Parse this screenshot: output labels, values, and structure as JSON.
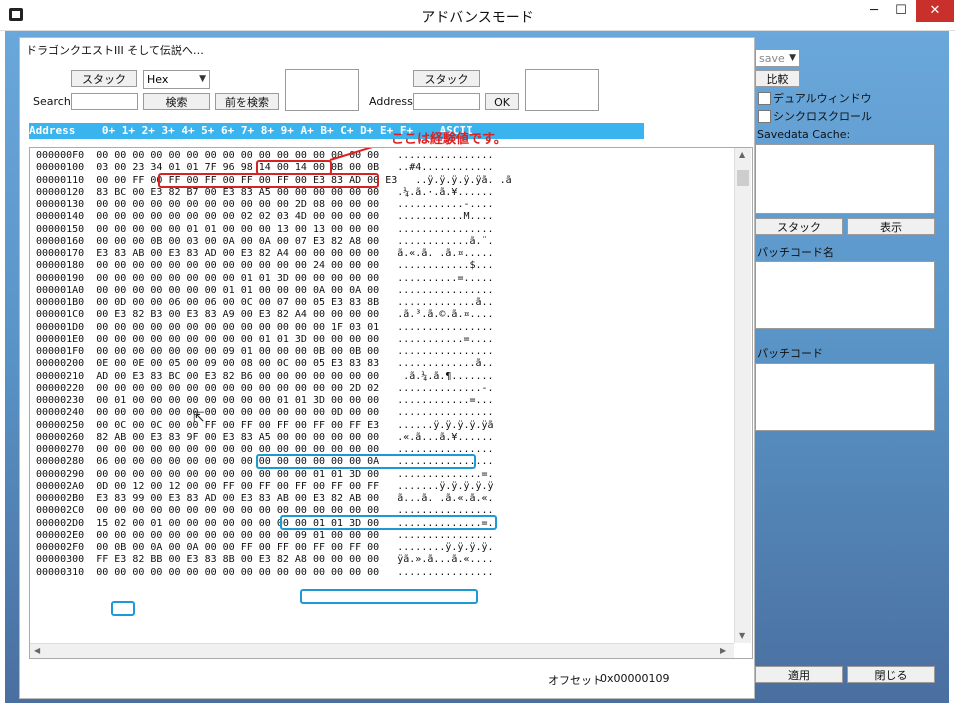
{
  "window": {
    "title": "アドバンスモード",
    "minimize": "─",
    "maximize": "☐",
    "close": "✕"
  },
  "game_title": "ドラゴンクエストIII そして伝説へ…",
  "search": {
    "stack_label": "スタック",
    "mode": "Hex",
    "label": "Search",
    "search_button": "検索",
    "prev_search_button": "前を検索",
    "value": ""
  },
  "address": {
    "stack_label": "スタック",
    "label": "Address",
    "ok_button": "OK",
    "value": ""
  },
  "hex_header": "Address    0+ 1+ 2+ 3+ 4+ 5+ 6+ 7+ 8+ 9+ A+ B+ C+ D+ E+ F+    ASCII",
  "rows": [
    {
      "addr": "000000F0",
      "hex": "00 00 00 00 00 00 00 00 00 00 00 00 00 00 00 00",
      "ascii": "................"
    },
    {
      "addr": "00000100",
      "hex": "03 00 23 34 01 01 7F 96 98 14 00 14 00 0B 00 0B",
      "ascii": "..#4............"
    },
    {
      "addr": "00000110",
      "hex": "00 00 FF 00 FF 00 FF 00 FF 00 FF 00 E3 83 AD 00 E3",
      "ascii": "..ÿ.ÿ.ÿ.ÿ.ÿã. .ã"
    },
    {
      "addr": "00000120",
      "hex": "83 BC 00 E3 82 B7 00 E3 83 A5 00 00 00 00 00 00",
      "ascii": ".¼.ã.·.ã.¥......"
    },
    {
      "addr": "00000130",
      "hex": "00 00 00 00 00 00 00 00 00 00 00 2D 08 00 00 00",
      "ascii": "...........-...."
    },
    {
      "addr": "00000140",
      "hex": "00 00 00 00 00 00 00 00 02 02 03 4D 00 00 00 00",
      "ascii": "...........M...."
    },
    {
      "addr": "00000150",
      "hex": "00 00 00 00 00 01 01 00 00 00 13 00 13 00 00 00",
      "ascii": "................"
    },
    {
      "addr": "00000160",
      "hex": "00 00 00 0B 00 03 00 0A 00 0A 00 07 E3 82 A8 00",
      "ascii": "............ã.¨."
    },
    {
      "addr": "00000170",
      "hex": "E3 83 AB 00 E3 83 AD 00 E3 82 A4 00 00 00 00 00",
      "ascii": "ã.«.ã. .ã.¤....."
    },
    {
      "addr": "00000180",
      "hex": "00 00 00 00 00 00 00 00 00 00 00 00 24 00 00 00",
      "ascii": "............$..."
    },
    {
      "addr": "00000190",
      "hex": "00 00 00 00 00 00 00 00 01 01 3D 00 00 00 00 00",
      "ascii": "..........=....."
    },
    {
      "addr": "000001A0",
      "hex": "00 00 00 00 00 00 00 01 01 00 00 00 0A 00 0A 00",
      "ascii": "................"
    },
    {
      "addr": "000001B0",
      "hex": "00 0D 00 00 06 00 06 00 0C 00 07 00 05 E3 83 8B",
      "ascii": ".............ã.."
    },
    {
      "addr": "000001C0",
      "hex": "00 E3 82 B3 00 E3 83 A9 00 E3 82 A4 00 00 00 00",
      "ascii": ".ã.³.ã.©.ã.¤...."
    },
    {
      "addr": "000001D0",
      "hex": "00 00 00 00 00 00 00 00 00 00 00 00 00 1F 03 01",
      "ascii": "................"
    },
    {
      "addr": "000001E0",
      "hex": "00 00 00 00 00 00 00 00 00 01 01 3D 00 00 00 00",
      "ascii": "...........=...."
    },
    {
      "addr": "000001F0",
      "hex": "00 00 00 00 00 00 00 09 01 00 00 00 0B 00 0B 00",
      "ascii": "................"
    },
    {
      "addr": "00000200",
      "hex": "0E 00 0E 00 05 00 09 00 08 00 0C 00 05 E3 83 83",
      "ascii": ".............ã.."
    },
    {
      "addr": "00000210",
      "hex": "AD 00 E3 83 BC 00 E3 82 B6 00 00 00 00 00 00 00",
      "ascii": " .ã.¼.ã.¶......."
    },
    {
      "addr": "00000220",
      "hex": "00 00 00 00 00 00 00 00 00 00 00 00 00 00 2D 02",
      "ascii": "..............-."
    },
    {
      "addr": "00000230",
      "hex": "00 01 00 00 00 00 00 00 00 00 01 01 3D 00 00 00",
      "ascii": "............=..."
    },
    {
      "addr": "00000240",
      "hex": "00 00 00 00 00 00 00 00 00 00 00 00 00 0D 00 00",
      "ascii": "................"
    },
    {
      "addr": "00000250",
      "hex": "00 0C 00 0C 00 00 FF 00 FF 00 FF 00 FF 00 FF E3",
      "ascii": "......ÿ.ÿ.ÿ.ÿ.ÿã"
    },
    {
      "addr": "00000260",
      "hex": "82 AB 00 E3 83 9F 00 E3 83 A5 00 00 00 00 00 00",
      "ascii": ".«.ã...ã.¥......"
    },
    {
      "addr": "00000270",
      "hex": "00 00 00 00 00 00 00 00 00 00 00 00 00 00 00 00",
      "ascii": "................"
    },
    {
      "addr": "00000280",
      "hex": "06 00 00 00 00 00 00 00 00 00 00 00 00 00 00 0A",
      "ascii": "................"
    },
    {
      "addr": "00000290",
      "hex": "00 00 00 00 00 00 00 00 00 00 00 00 01 01 3D 00",
      "ascii": "..............=."
    },
    {
      "addr": "000002A0",
      "hex": "0D 00 12 00 12 00 00 FF 00 FF 00 FF 00 FF 00 FF",
      "ascii": ".......ÿ.ÿ.ÿ.ÿ.ÿ"
    },
    {
      "addr": "000002B0",
      "hex": "E3 83 99 00 E3 83 AD 00 E3 83 AB 00 E3 82 AB 00",
      "ascii": "ã...ã. .ã.«.ã.«."
    },
    {
      "addr": "000002C0",
      "hex": "00 00 00 00 00 00 00 00 00 00 00 00 00 00 00 00",
      "ascii": "................"
    },
    {
      "addr": "000002D0",
      "hex": "15 02 00 01 00 00 00 00 00 00 00 00 01 01 3D 00",
      "ascii": "..............=."
    },
    {
      "addr": "000002E0",
      "hex": "00 00 00 00 00 00 00 00 00 00 00 09 01 00 00 00",
      "ascii": "................"
    },
    {
      "addr": "000002F0",
      "hex": "00 0B 00 0A 00 0A 00 00 FF 00 FF 00 FF 00 FF 00",
      "ascii": "........ÿ.ÿ.ÿ.ÿ."
    },
    {
      "addr": "00000300",
      "hex": "FF E3 82 BB 00 E3 83 8B 00 E3 82 A8 00 00 00 00",
      "ascii": "ÿã.».ã...ã.«...."
    },
    {
      "addr": "00000310",
      "hex": "00 00 00 00 00 00 00 00 00 00 00 00 00 00 00 00",
      "ascii": "................"
    }
  ],
  "annotation": "ここは経験値です。",
  "right_panel": {
    "save_select": "save",
    "compare_button": "比較",
    "dual_window_label": "デュアルウィンドウ",
    "sync_scroll_label": "シンクロスクロール",
    "savedata_cache_label": "Savedata Cache:",
    "stack_button": "スタック",
    "show_button": "表示",
    "patch_name_label": "パッチコード名",
    "patch_code_label": "パッチコード"
  },
  "footer": {
    "offset_label": "オフセット",
    "offset_value": "0x00000109",
    "apply_button": "適用",
    "close_button": "閉じる"
  },
  "colors": {
    "header_bg": "#3ab4ee",
    "annotation_red": "#e02020",
    "highlight_blue": "#1d9ad6",
    "client_bg": "#5a95c8"
  }
}
